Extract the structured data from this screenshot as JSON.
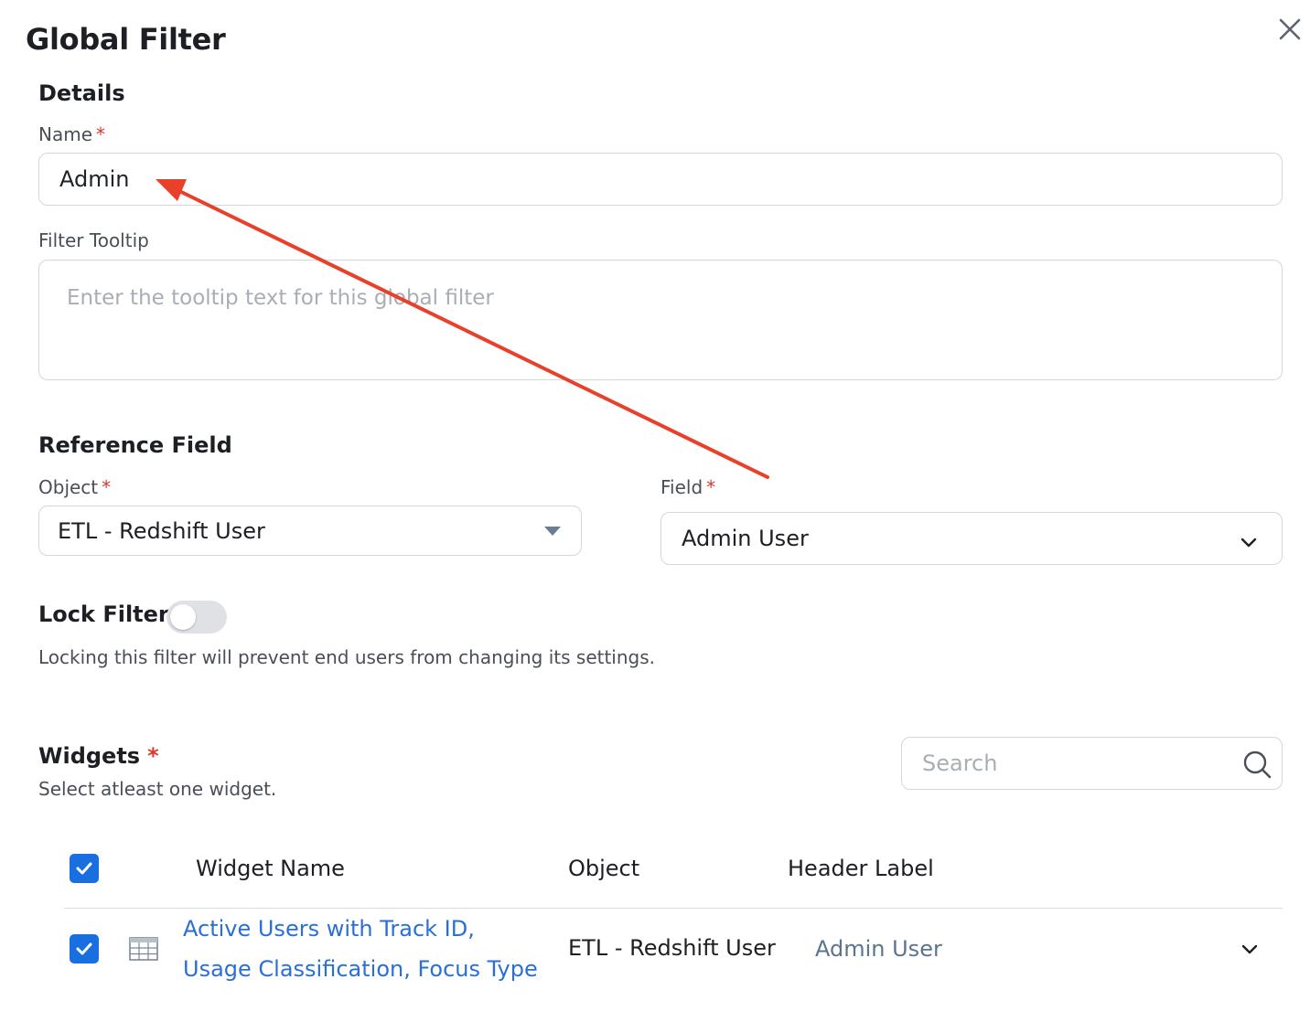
{
  "dialog": {
    "title": "Global Filter"
  },
  "details": {
    "heading": "Details",
    "name_label": "Name",
    "required_mark": "*",
    "name_value": "Admin",
    "tooltip_label": "Filter Tooltip",
    "tooltip_placeholder": "Enter the tooltip text for this global filter"
  },
  "reference": {
    "heading": "Reference Field",
    "object_label": "Object",
    "object_value": "ETL - Redshift User",
    "field_label": "Field",
    "field_value": "Admin User"
  },
  "lock": {
    "label": "Lock Filter",
    "enabled": false,
    "helper": "Locking this filter will prevent end users from changing its settings."
  },
  "widgets": {
    "heading": "Widgets",
    "helper": "Select atleast one widget.",
    "search_placeholder": "Search",
    "columns": {
      "name": "Widget Name",
      "object": "Object",
      "header_label": "Header Label"
    },
    "rows": [
      {
        "name_line1": "Active Users with Track ID,",
        "name_line2": "Usage Classification, Focus Type",
        "object": "ETL - Redshift User",
        "header_label": "Admin User",
        "checked": true
      }
    ]
  },
  "colors": {
    "accent": "#1a6fe0",
    "link": "#2a6fd6",
    "required": "#d63a2e",
    "annotation_arrow": "#e8402b"
  }
}
